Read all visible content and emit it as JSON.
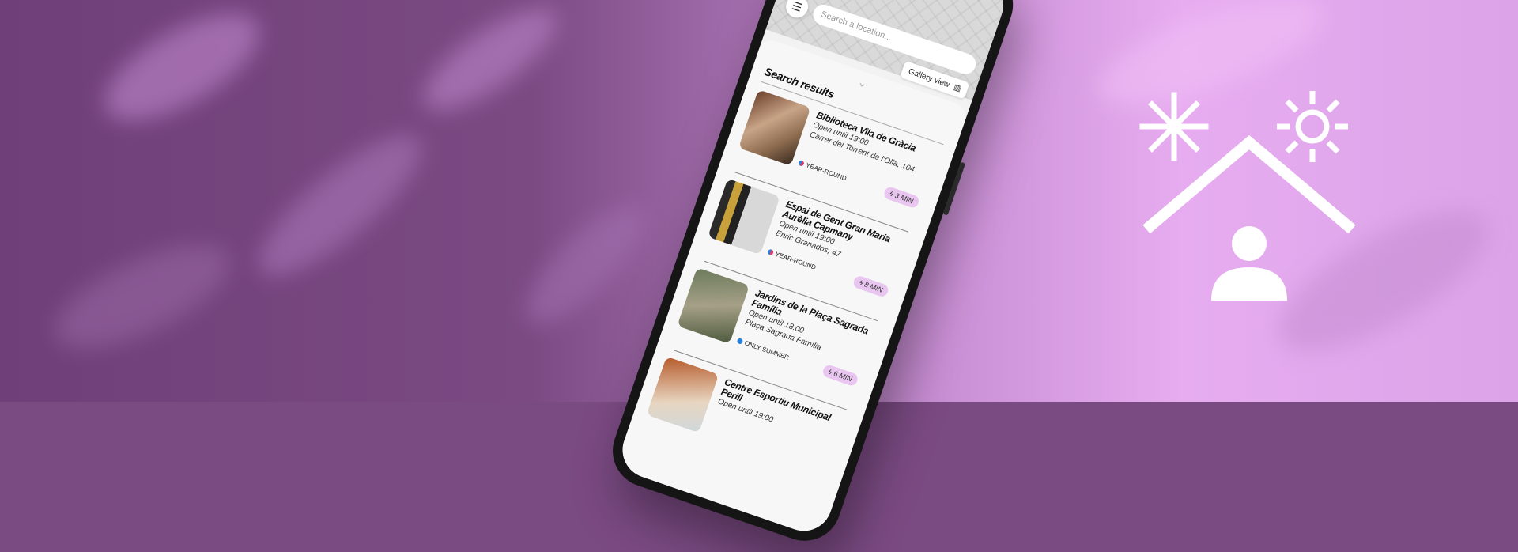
{
  "search": {
    "placeholder": "Search a location..."
  },
  "gallery": {
    "label": "Gallery view"
  },
  "results_title": "Search results",
  "results": [
    {
      "name": "Biblioteca Vila de Gràcia",
      "hours": "Open until 19:00",
      "address": "Carrer del Torrent de l'Olla, 104",
      "season": "YEAR-ROUND",
      "time": "3 MIN"
    },
    {
      "name": "Espai de Gent Gran Maria Aurèlia Capmany",
      "hours": "Open until 19:00",
      "address": "Enric Granados, 47",
      "season": "YEAR-ROUND",
      "time": "8 MIN"
    },
    {
      "name": "Jardins de la Plaça Sagrada Família",
      "hours": "Open until 18:00",
      "address": "Plaça Sagrada Família",
      "season": "ONLY SUMMER",
      "time": "6 MIN"
    },
    {
      "name": "Centre Esportiu Municipal Perill",
      "hours": "Open until 19:00",
      "address": "",
      "season": "",
      "time": ""
    }
  ],
  "colors": {
    "accent": "#e8c6ef",
    "bg_dark": "#7a4a82",
    "bg_light": "#e7acf0"
  }
}
